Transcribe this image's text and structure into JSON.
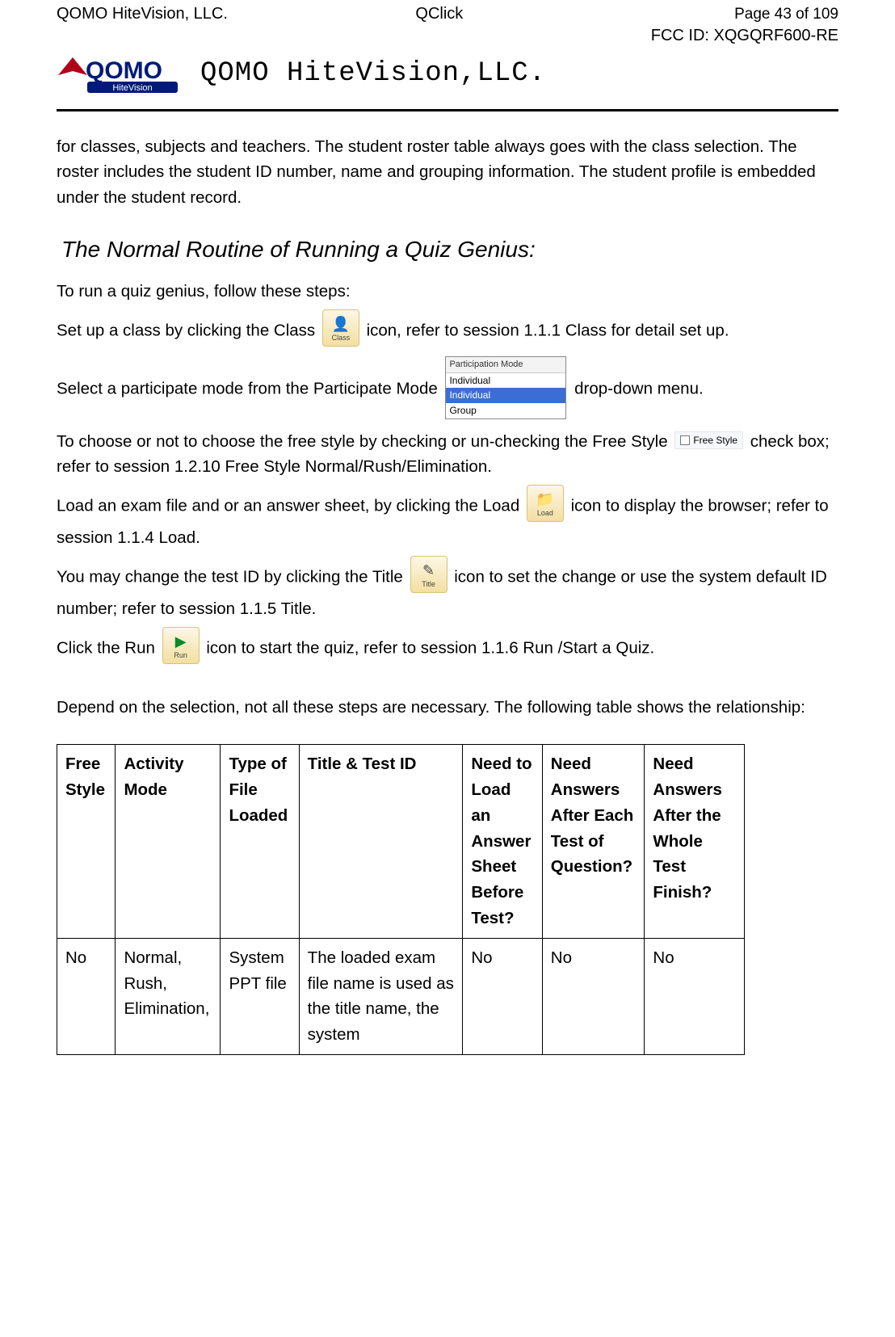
{
  "header": {
    "company": "QOMO HiteVision, LLC.",
    "product": "QClick",
    "page_prefix": "Page ",
    "page_current": "43",
    "page_of": " of ",
    "page_total": "109",
    "fcc": "FCC ID: XQGQRF600-RE",
    "brand_big": "QOMO HiteVision,LLC."
  },
  "intro_paragraph": "for classes, subjects and teachers. The student roster table always goes with the class selection. The roster includes the student ID number, name and grouping information. The student profile is embedded under the student record.",
  "section_heading": "The Normal Routine of Running a Quiz Genius:",
  "steps": {
    "lead": "To run a quiz genius, follow these steps:",
    "s1_a": "Set up a class by clicking the Class ",
    "s1_b": "icon, refer to session 1.1.1 Class for detail set up.",
    "s2_a": "Select a participate mode from the Participate Mode ",
    "s2_b": " drop-down menu.",
    "s3_a": "To choose or not to choose the free style by checking or un-checking the Free Style ",
    "s3_b": "check box; refer to session 1.2.10 Free Style Normal/Rush/Elimination.",
    "s4_a": "Load an exam file and or an answer sheet, by clicking the Load ",
    "s4_b": "icon to display the browser; refer to session 1.1.4 Load.",
    "s5_a": "You may change the test ID by clicking the Title",
    "s5_b": " icon to set the change or use the system default ID number; refer to session 1.1.5 Title.",
    "s6_a": "Click the Run ",
    "s6_b": " icon to start the quiz, refer to session 1.1.6 Run /Start a Quiz.",
    "s7": "Depend on the selection, not all these steps are necessary. The following table shows the relationship:"
  },
  "icons": {
    "class_label": "Class",
    "load_label": "Load",
    "title_label": "Title",
    "run_label": "Run"
  },
  "dropdown": {
    "title": "Participation Mode",
    "options": [
      "Individual",
      "Individual",
      "Group"
    ],
    "selected_index": 1
  },
  "freestyle": {
    "label": "Free Style"
  },
  "table": {
    "headers": [
      "Free Style",
      "Activity Mode",
      "Type of File Loaded",
      "Title & Test ID",
      "Need to Load an Answer Sheet Before Test?",
      "Need Answers After Each Test of Question?",
      "Need Answers After the Whole Test Finish?"
    ],
    "rows": [
      [
        "No",
        "Normal, Rush, Elimination,",
        "System PPT file",
        "The loaded exam file name is used as the title name, the system",
        "No",
        "No",
        "No"
      ]
    ]
  }
}
